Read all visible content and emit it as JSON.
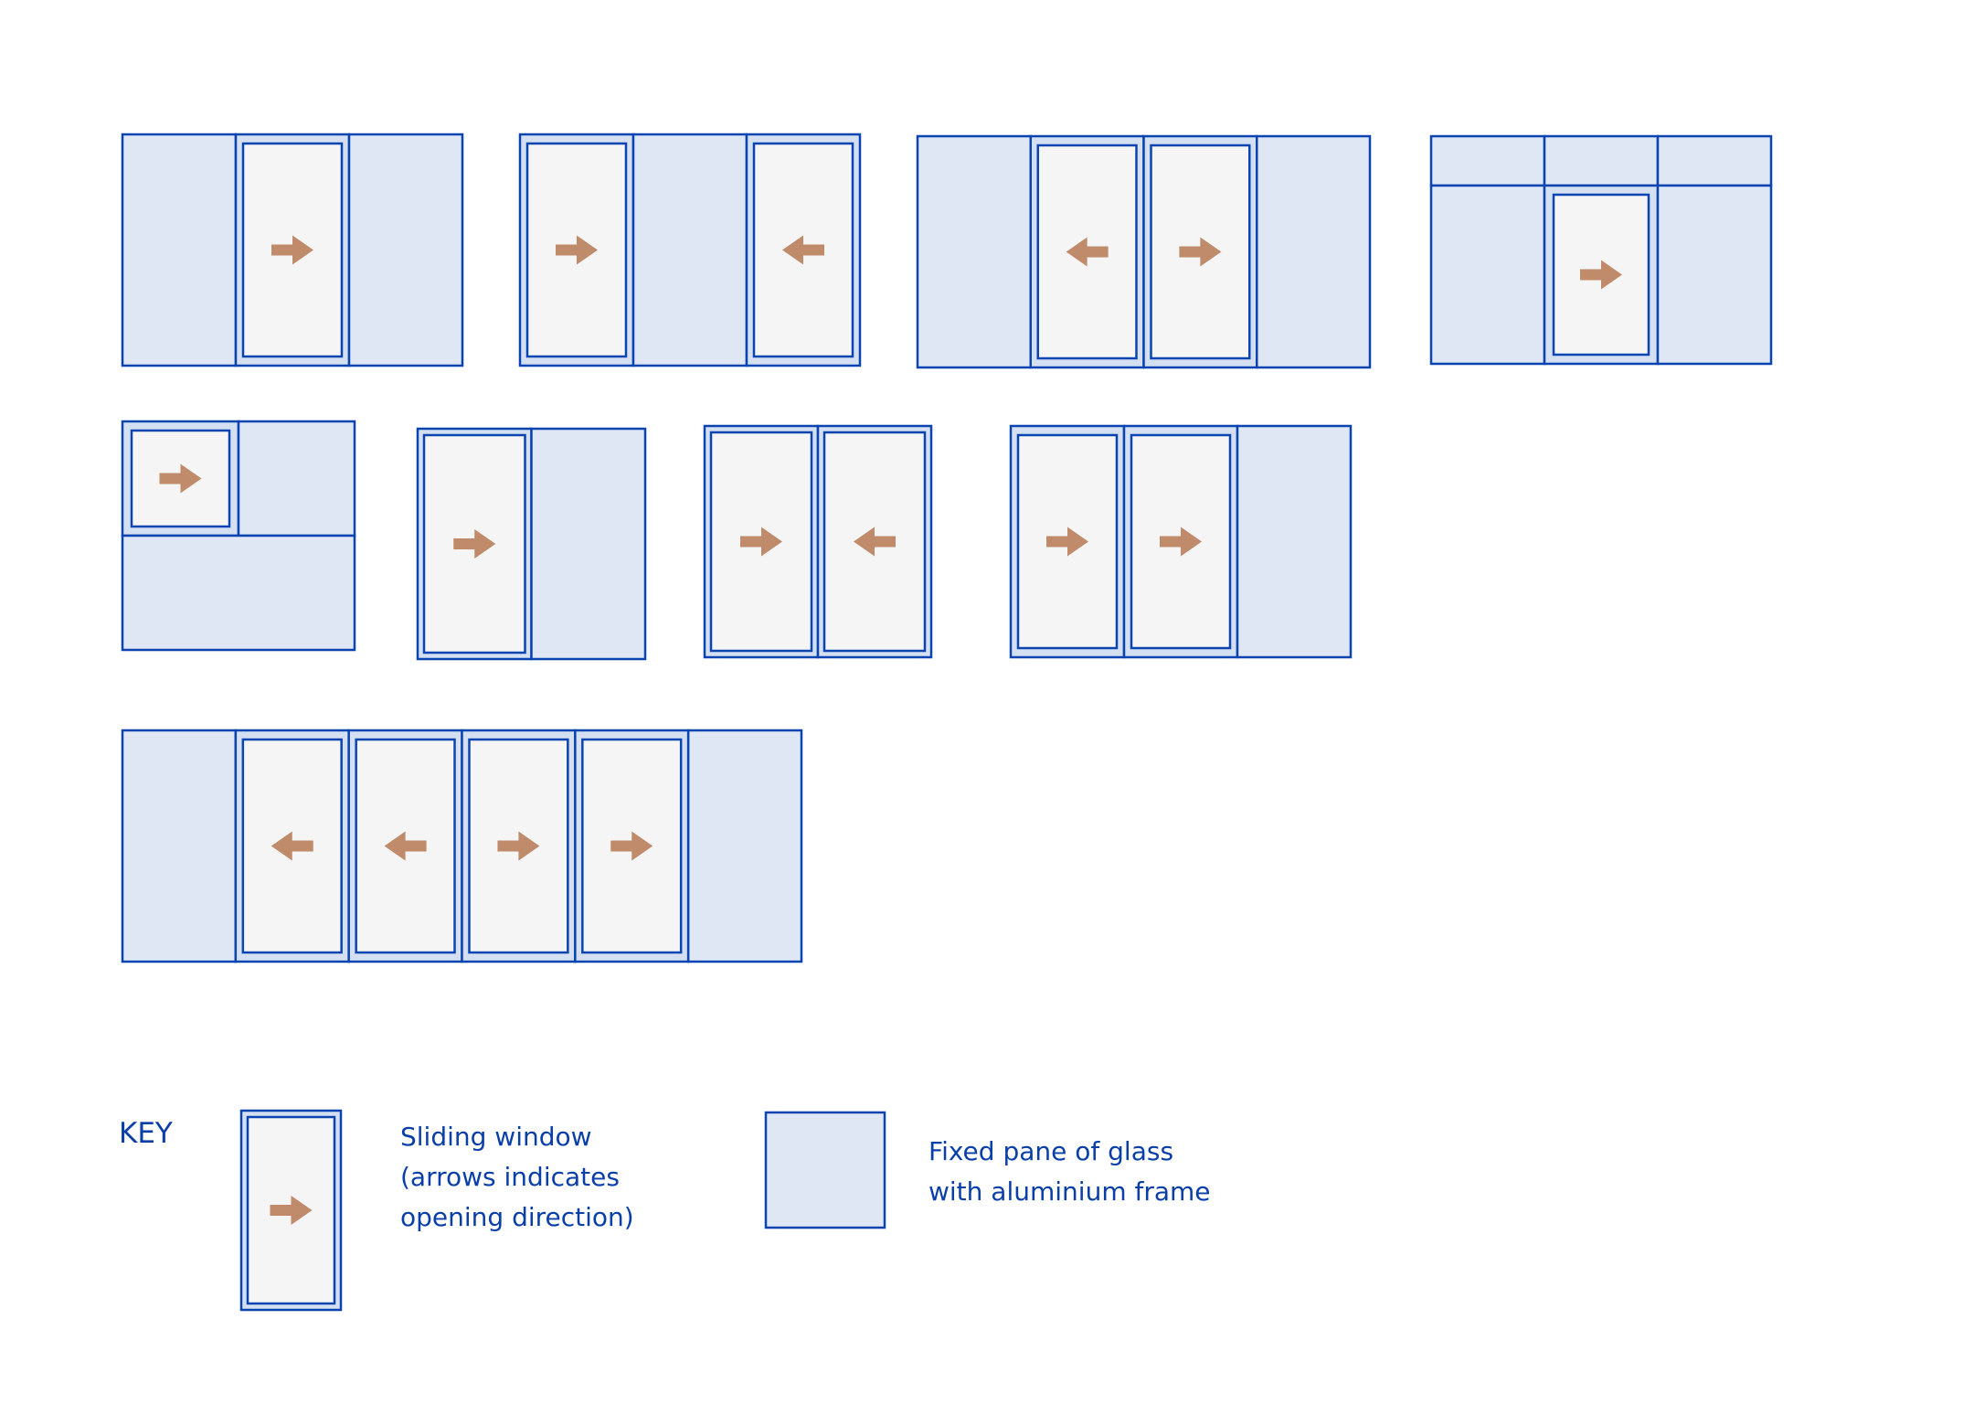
{
  "colors": {
    "frame": "#0a44b0",
    "fixed_fill": "#e0e7f4",
    "sliding_frame_fill": "#d4e0f2",
    "sliding_glass": "#f5f5f5",
    "arrow": "#bf8b6a",
    "text": "#0a3fa8"
  },
  "diagrams": [
    {
      "name": "diagram-1",
      "layout": "row",
      "panels": [
        {
          "type": "fixed"
        },
        {
          "type": "sliding",
          "dir": "right"
        },
        {
          "type": "fixed"
        }
      ]
    },
    {
      "name": "diagram-2",
      "layout": "row",
      "panels": [
        {
          "type": "sliding",
          "dir": "right"
        },
        {
          "type": "fixed"
        },
        {
          "type": "sliding",
          "dir": "left"
        }
      ]
    },
    {
      "name": "diagram-3",
      "layout": "row",
      "panels": [
        {
          "type": "fixed"
        },
        {
          "type": "sliding",
          "dir": "left"
        },
        {
          "type": "sliding",
          "dir": "right"
        },
        {
          "type": "fixed"
        }
      ]
    },
    {
      "name": "diagram-4",
      "layout": "transom",
      "top_panels": [
        {
          "type": "fixed"
        },
        {
          "type": "fixed"
        },
        {
          "type": "fixed"
        }
      ],
      "panels": [
        {
          "type": "fixed"
        },
        {
          "type": "sliding",
          "dir": "right"
        },
        {
          "type": "fixed"
        }
      ]
    },
    {
      "name": "diagram-5",
      "layout": "quad",
      "top_panels": [
        {
          "type": "sliding",
          "dir": "right"
        },
        {
          "type": "fixed"
        }
      ],
      "bottom_panels": [
        {
          "type": "fixed"
        }
      ]
    },
    {
      "name": "diagram-6",
      "layout": "row",
      "panels": [
        {
          "type": "sliding",
          "dir": "right"
        },
        {
          "type": "fixed"
        }
      ]
    },
    {
      "name": "diagram-7",
      "layout": "row",
      "panels": [
        {
          "type": "sliding",
          "dir": "right"
        },
        {
          "type": "sliding",
          "dir": "left"
        }
      ]
    },
    {
      "name": "diagram-8",
      "layout": "row",
      "panels": [
        {
          "type": "sliding",
          "dir": "right"
        },
        {
          "type": "sliding",
          "dir": "right"
        },
        {
          "type": "fixed"
        }
      ]
    },
    {
      "name": "diagram-9",
      "layout": "row",
      "panels": [
        {
          "type": "fixed"
        },
        {
          "type": "sliding",
          "dir": "left"
        },
        {
          "type": "sliding",
          "dir": "left"
        },
        {
          "type": "sliding",
          "dir": "right"
        },
        {
          "type": "sliding",
          "dir": "right"
        },
        {
          "type": "fixed"
        }
      ]
    }
  ],
  "key": {
    "title": "KEY",
    "sliding": {
      "dir": "right",
      "label": "Sliding window\n(arrows indicates\nopening direction)"
    },
    "fixed": {
      "label": "Fixed pane of glass\nwith aluminium frame"
    }
  }
}
